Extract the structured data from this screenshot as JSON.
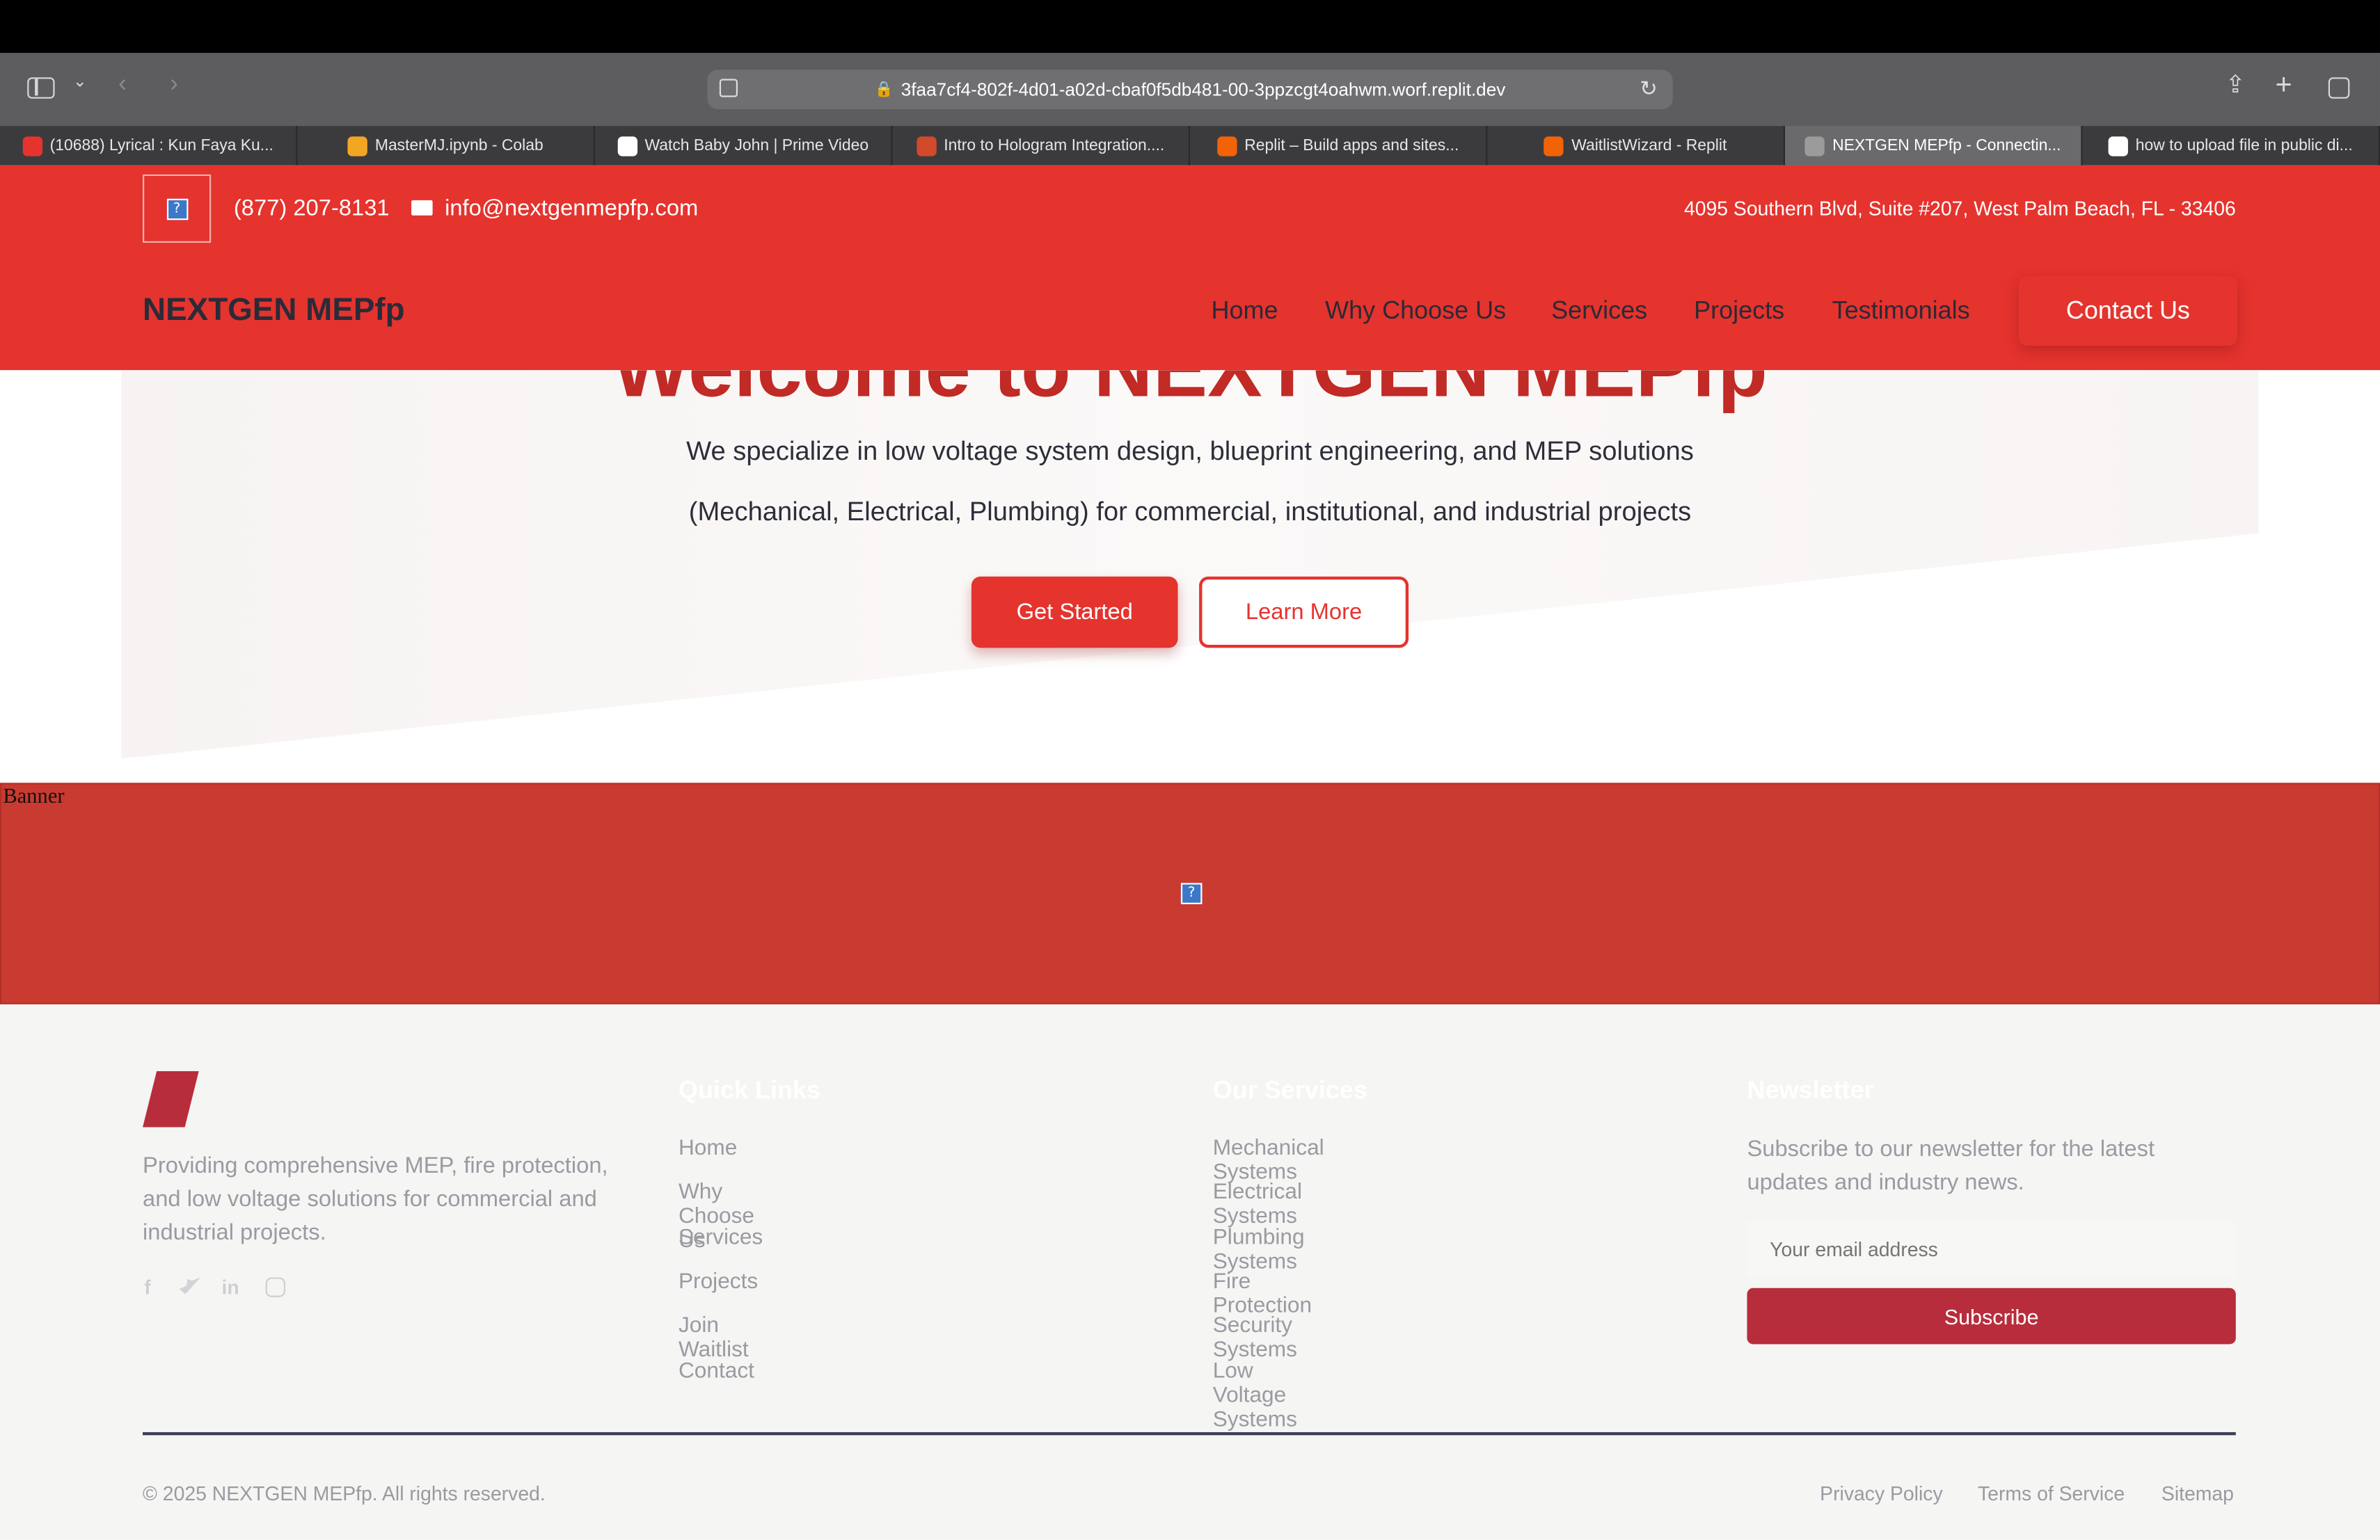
{
  "browser": {
    "url": "3faa7cf4-802f-4d01-a02d-cbaf0f5db481-00-3ppzcgt4oahwm.worf.replit.dev",
    "tabs": [
      {
        "label": "(10688) Lyrical : Kun Faya Ku...",
        "favicon_color": "#e5332e",
        "active": false
      },
      {
        "label": "MasterMJ.ipynb - Colab",
        "favicon_color": "#f3a623",
        "active": false
      },
      {
        "label": "Watch Baby John | Prime Video",
        "favicon_color": "#ffffff",
        "active": false
      },
      {
        "label": "Intro to Hologram Integration....",
        "favicon_color": "#d14a2b",
        "active": false
      },
      {
        "label": "Replit – Build apps and sites...",
        "favicon_color": "#f26207",
        "active": false
      },
      {
        "label": "WaitlistWizard - Replit",
        "favicon_color": "#f26207",
        "active": false
      },
      {
        "label": "NEXTGEN MEPfp - Connectin...",
        "favicon_color": "#9b9b9b",
        "active": true
      },
      {
        "label": "how to upload file in public di...",
        "favicon_color": "#ffffff",
        "active": false
      }
    ]
  },
  "topbar": {
    "logo_icon": "?",
    "phone": "(877) 207-8131",
    "email": "info@nextgenmepfp.com",
    "address": "4095 Southern Blvd, Suite #207, West Palm Beach, FL - 33406"
  },
  "nav": {
    "brand": "NEXTGEN MEPfp",
    "links": [
      "Home",
      "Why Choose Us",
      "Services",
      "Projects",
      "Testimonials"
    ],
    "cta": "Contact Us"
  },
  "hero": {
    "title": "Welcome to NEXTGEN MEPfp",
    "line1": "We specialize in low voltage system design, blueprint engineering, and MEP solutions",
    "line2": "(Mechanical, Electrical, Plumbing) for commercial, institutional, and industrial projects",
    "primary_button": "Get Started",
    "secondary_button": "Learn More"
  },
  "banner": {
    "alt_text": "Banner",
    "icon": "?"
  },
  "footer": {
    "about": [
      "Providing comprehensive MEP, fire protection,",
      "and low voltage solutions for commercial and",
      "industrial projects."
    ],
    "social": [
      "f",
      "twitter",
      "in",
      "instagram"
    ],
    "quick_links": {
      "heading": "Quick Links",
      "items": [
        "Home",
        "Why Choose Us",
        "Services",
        "Projects",
        "Join Waitlist",
        "Contact"
      ]
    },
    "services": {
      "heading": "Our Services",
      "items": [
        "Mechanical Systems",
        "Electrical Systems",
        "Plumbing Systems",
        "Fire Protection",
        "Security Systems",
        "Low Voltage Systems"
      ]
    },
    "newsletter": {
      "heading": "Newsletter",
      "text": [
        "Subscribe to our newsletter for the latest",
        "updates and industry news."
      ],
      "placeholder": "Your email address",
      "button": "Subscribe"
    },
    "copyright": "© 2025 NEXTGEN MEPfp. All rights reserved.",
    "legal": [
      "Privacy Policy",
      "Terms of Service",
      "Sitemap"
    ]
  }
}
